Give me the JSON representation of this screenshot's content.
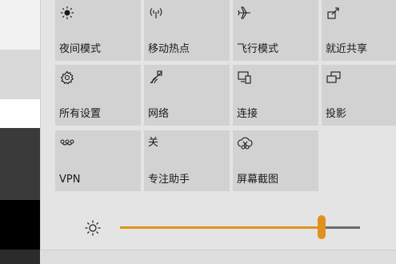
{
  "quick_actions": [
    {
      "label": "夜间模式",
      "icon": "night-light-icon"
    },
    {
      "label": "移动热点",
      "icon": "mobile-hotspot-icon"
    },
    {
      "label": "飞行模式",
      "icon": "airplane-mode-icon"
    },
    {
      "label": "就近共享",
      "icon": "nearby-sharing-icon"
    },
    {
      "label": "所有设置",
      "icon": "settings-gear-icon"
    },
    {
      "label": "网络",
      "icon": "network-icon"
    },
    {
      "label": "连接",
      "icon": "connect-icon"
    },
    {
      "label": "投影",
      "icon": "project-icon"
    },
    {
      "label": "VPN",
      "icon": "vpn-icon"
    },
    {
      "label": "专注助手",
      "icon": "focus-assist-icon"
    },
    {
      "label": "屏幕截图",
      "icon": "screen-snip-icon"
    }
  ],
  "focus_assist_icon_char": "关",
  "brightness": {
    "icon": "brightness-sun-icon",
    "level_fraction": 0.84
  },
  "colors": {
    "accent": "#e0911d",
    "tile": "#d2d2d2",
    "panel": "#e4e4e4"
  }
}
